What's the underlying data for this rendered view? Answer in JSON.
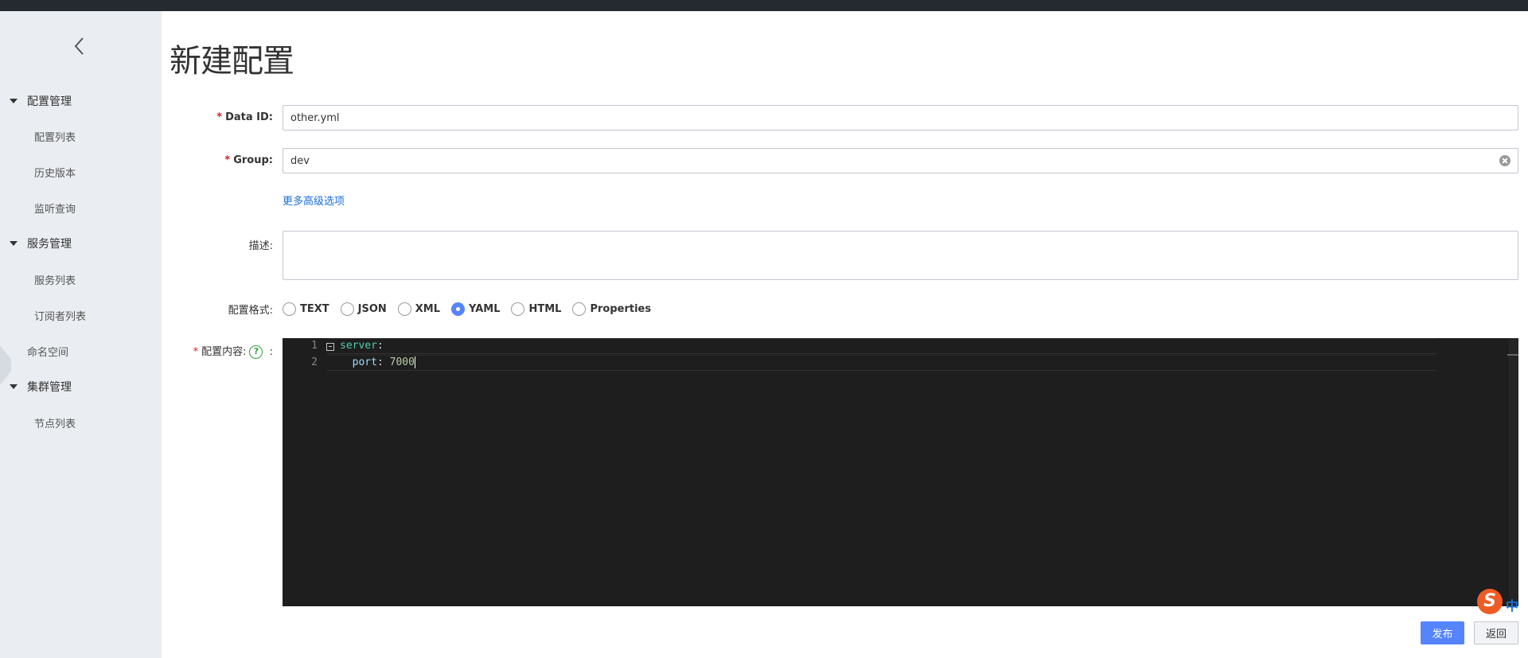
{
  "sidebar": {
    "groups": [
      {
        "label": "配置管理",
        "items": [
          "配置列表",
          "历史版本",
          "监听查询"
        ]
      },
      {
        "label": "服务管理",
        "items": [
          "服务列表",
          "订阅者列表"
        ]
      },
      {
        "label": "集群管理",
        "items": [
          "节点列表"
        ]
      }
    ],
    "namespace": "命名空间"
  },
  "page": {
    "title": "新建配置"
  },
  "form": {
    "data_id": {
      "label": "Data ID:",
      "value": "other.yml"
    },
    "group": {
      "label": "Group:",
      "value": "dev"
    },
    "more_options": "更多高级选项",
    "description": {
      "label": "描述:",
      "value": ""
    },
    "format": {
      "label": "配置格式:",
      "options": [
        "TEXT",
        "JSON",
        "XML",
        "YAML",
        "HTML",
        "Properties"
      ],
      "selected": "YAML"
    },
    "content": {
      "label": "配置内容:",
      "colon": ":",
      "help": "?",
      "lines": [
        {
          "no": "1",
          "key": "server",
          "sep": ":",
          "value": ""
        },
        {
          "no": "2",
          "key": "port",
          "sep": ": ",
          "value": "7000"
        }
      ]
    },
    "required_mark": "*"
  },
  "ime": {
    "logo": "S",
    "mode": "中"
  },
  "buttons": {
    "publish": "发布",
    "back": "返回"
  },
  "colors": {
    "primary": "#5584ff",
    "sidebar_bg": "#eaedf1",
    "editor_bg": "#1e1e1e",
    "link": "#1a6fd8"
  }
}
